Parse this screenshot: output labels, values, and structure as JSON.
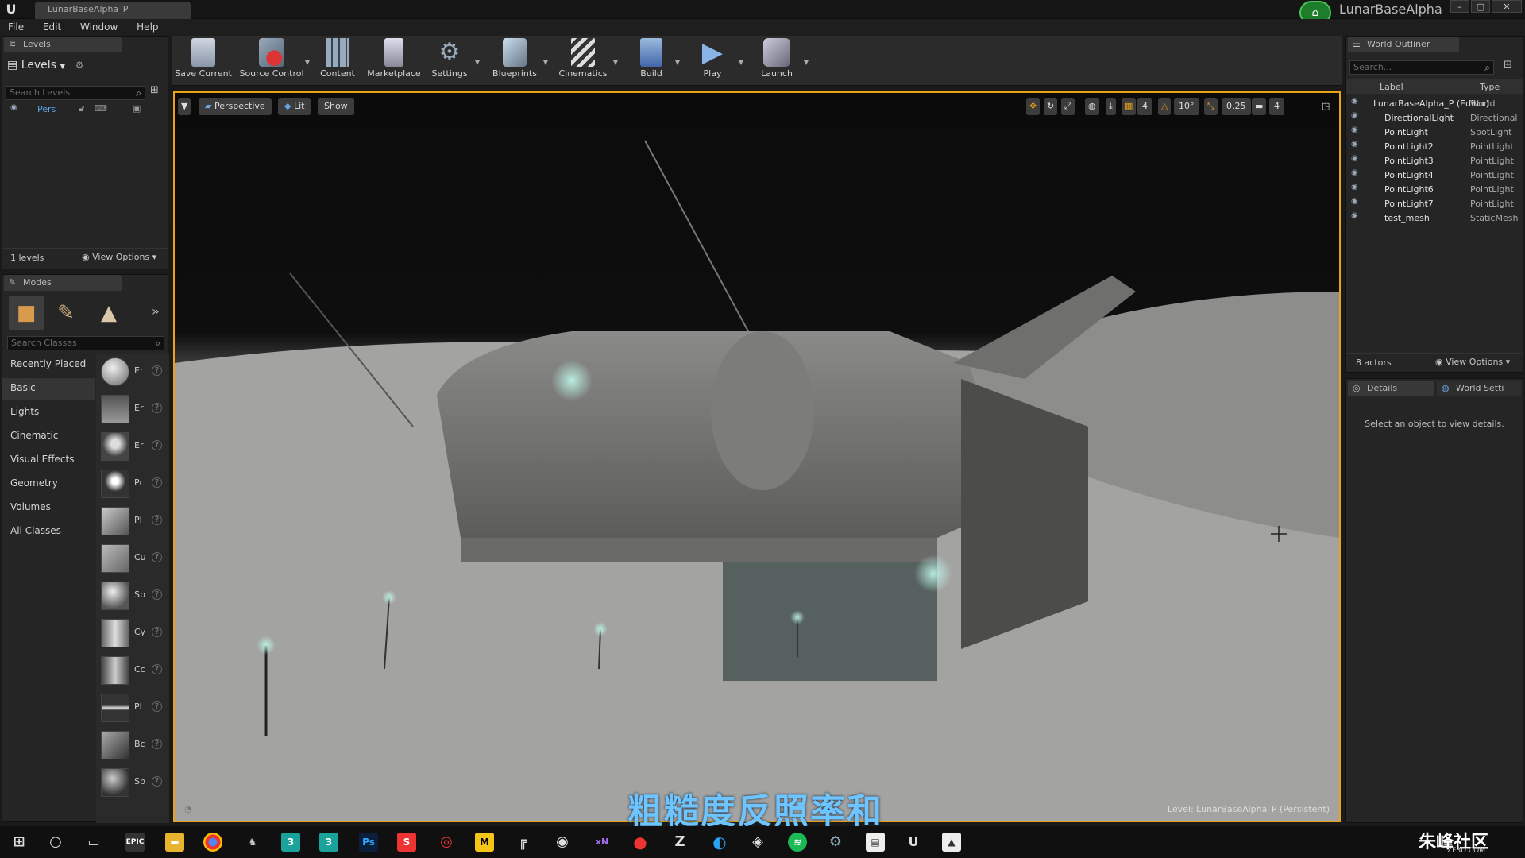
{
  "window": {
    "doc_tab": "LunarBaseAlpha_P",
    "project_name": "LunarBaseAlpha",
    "controls": [
      "–",
      "▢",
      "✕"
    ]
  },
  "menu": [
    "File",
    "Edit",
    "Window",
    "Help"
  ],
  "levels_panel": {
    "tab": "Levels",
    "header": "Levels",
    "search_placeholder": "Search Levels",
    "level_item": "Pers",
    "count": "1 levels",
    "view_options": "View Options"
  },
  "modes_panel": {
    "tab": "Modes",
    "search_placeholder": "Search Classes",
    "categories": [
      "Recently Placed",
      "Basic",
      "Lights",
      "Cinematic",
      "Visual Effects",
      "Geometry",
      "Volumes",
      "All Classes"
    ],
    "selected_category": "Basic",
    "items": [
      "Er",
      "Er",
      "Er",
      "Pc",
      "Pl",
      "Cu",
      "Sp",
      "Cy",
      "Cc",
      "Pl",
      "Bc",
      "Sp"
    ]
  },
  "toolbar": {
    "buttons": [
      {
        "label": "Save Current",
        "icon": "save-icon"
      },
      {
        "label": "Source Control",
        "icon": "source-control-icon"
      },
      {
        "label": "Content",
        "icon": "content-icon"
      },
      {
        "label": "Marketplace",
        "icon": "marketplace-icon"
      },
      {
        "label": "Settings",
        "icon": "settings-icon"
      },
      {
        "label": "Blueprints",
        "icon": "blueprints-icon"
      },
      {
        "label": "Cinematics",
        "icon": "cinematics-icon"
      },
      {
        "label": "Build",
        "icon": "build-icon"
      },
      {
        "label": "Play",
        "icon": "play-icon"
      },
      {
        "label": "Launch",
        "icon": "launch-icon"
      }
    ]
  },
  "viewport": {
    "perspective": "Perspective",
    "lit": "Lit",
    "show": "Show",
    "grid_snap": "4",
    "rot_snap": "10°",
    "scale_snap": "0.25",
    "camera_speed": "4",
    "level_label": "Level:  LunarBaseAlpha_P (Persistent)",
    "subtitle": "粗糙度反照率和"
  },
  "world_outliner": {
    "tab": "World Outliner",
    "search_placeholder": "Search...",
    "col_label": "Label",
    "col_type": "Type",
    "rows": [
      {
        "label": "LunarBaseAlpha_P (Editor)",
        "type": "World"
      },
      {
        "label": "DirectionalLight",
        "type": "DirectionalLight"
      },
      {
        "label": "PointLight",
        "type": "SpotLight"
      },
      {
        "label": "PointLight2",
        "type": "PointLight"
      },
      {
        "label": "PointLight3",
        "type": "PointLight"
      },
      {
        "label": "PointLight4",
        "type": "PointLight"
      },
      {
        "label": "PointLight6",
        "type": "PointLight"
      },
      {
        "label": "PointLight7",
        "type": "PointLight"
      },
      {
        "label": "test_mesh",
        "type": "StaticMesh"
      }
    ],
    "actor_count": "8 actors",
    "view_options": "View Options"
  },
  "details": {
    "tab": "Details",
    "world_tab": "World Setti",
    "empty_text": "Select an object to view details."
  },
  "watermark": {
    "text": "朱峰社区",
    "sub": "ZF3D.COM"
  },
  "taskbar": {
    "apps": [
      "windows-icon",
      "search-icon",
      "task-view-icon",
      "epic-icon",
      "explorer-icon",
      "chrome-icon",
      "ue-icon",
      "3dsmax-icon",
      "3dsmax2-icon",
      "photoshop-icon",
      "substance-icon",
      "davinci-icon",
      "marmoset-icon",
      "houdini-icon",
      "obs-icon",
      "xnormal-icon",
      "record-icon",
      "zbrush-icon",
      "browser-icon",
      "unity-icon",
      "spotify-icon",
      "steam-icon",
      "notes-icon",
      "unreal-icon",
      "photos-icon"
    ]
  },
  "colors": {
    "accent": "#e8a317",
    "subtitle": "#6ec4ff",
    "badge": "#1d7d2b"
  }
}
